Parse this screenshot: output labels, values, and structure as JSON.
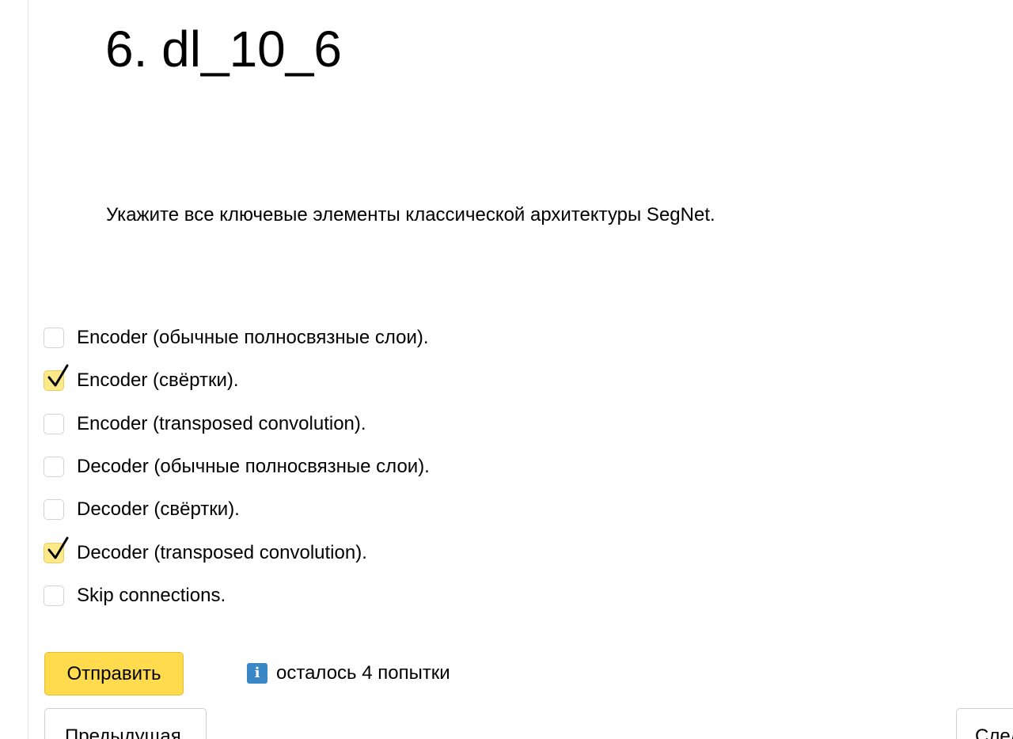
{
  "question": {
    "title": "6. dl_10_6",
    "text": "Укажите все ключевые элементы классической архитектуры SegNet."
  },
  "options": [
    {
      "label": "Encoder (обычные полносвязные слои).",
      "checked": false
    },
    {
      "label": "Encoder (свёртки).",
      "checked": true
    },
    {
      "label": "Encoder (transposed convolution).",
      "checked": false
    },
    {
      "label": "Decoder (обычные полносвязные слои).",
      "checked": false
    },
    {
      "label": "Decoder (свёртки).",
      "checked": false
    },
    {
      "label": "Decoder (transposed convolution).",
      "checked": true
    },
    {
      "label": "Skip connections.",
      "checked": false
    }
  ],
  "actions": {
    "submit_label": "Отправить",
    "attempts_icon": "info-icon",
    "attempts_icon_glyph": "i",
    "attempts_text": "осталось 4 попытки",
    "prev_label": "Предыдущая",
    "next_label": "Следующая"
  },
  "colors": {
    "submit_bg": "#ffdb4d",
    "checked_bg": "#fde98a",
    "info_icon_bg": "#3a87c8"
  }
}
